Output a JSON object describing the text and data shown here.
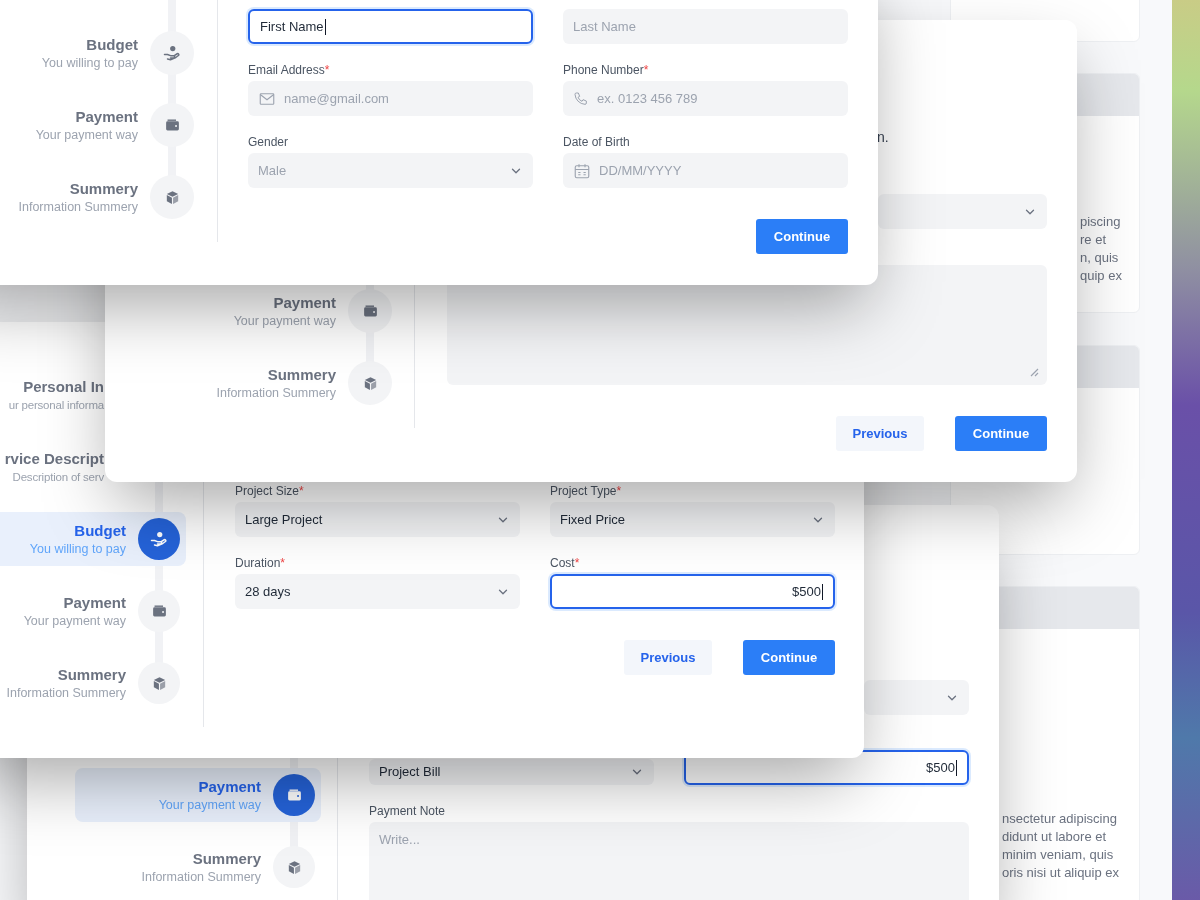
{
  "background_card_text": [
    {
      "lines": [
        "piscing",
        "re et",
        "n, quis",
        "quip ex"
      ]
    },
    {
      "lines": [
        "nsectetur adipiscing",
        "didunt ut labore et",
        "minim veniam, quis",
        "oris nisi ut aliquip ex"
      ]
    }
  ],
  "cards": [
    {
      "steps": [
        {
          "title": "Budget",
          "subtitle": "You willing to pay",
          "kind": "coin",
          "selected": false
        },
        {
          "title": "Payment",
          "subtitle": "Your payment way",
          "kind": "wallet",
          "selected": false
        },
        {
          "title": "Summery",
          "subtitle": "Information Summery",
          "kind": "box",
          "selected": false
        }
      ],
      "fields": [
        {
          "kind": "text",
          "value": "First Name",
          "focused": true
        },
        {
          "kind": "text",
          "placeholder": "Last Name",
          "focused": false
        },
        {
          "kind": "email",
          "label": "Email Address",
          "required_mark": "*",
          "placeholder": "name@gmail.com",
          "focused": false
        },
        {
          "kind": "phone",
          "label": "Phone Number",
          "required_mark": "*",
          "placeholder": "ex. 0123 456 789",
          "focused": false
        },
        {
          "kind": "select",
          "label": "Gender",
          "placeholder": "Male"
        },
        {
          "kind": "date",
          "label": "Date of Birth",
          "placeholder": "DD/MM/YYYY"
        }
      ],
      "buttons": [
        {
          "kind": "primary",
          "label": "Continue"
        }
      ]
    },
    {
      "steps": [
        {
          "title": "Payment",
          "subtitle": "Your payment way",
          "kind": "wallet",
          "selected": false
        },
        {
          "title": "Summery",
          "subtitle": "Information Summery",
          "kind": "box",
          "selected": false
        }
      ],
      "paragraph_fragment": "n.",
      "fields": [
        {
          "kind": "select"
        },
        {
          "kind": "textarea"
        }
      ],
      "buttons": [
        {
          "kind": "secondary",
          "label": "Previous"
        },
        {
          "kind": "primary",
          "label": "Continue"
        }
      ]
    },
    {
      "steps": [
        {
          "title": "Personal In",
          "subtitle": "ur personal informa",
          "kind": "text",
          "selected": false
        },
        {
          "title": "rvice Descript",
          "subtitle": "Description of serv",
          "kind": "text",
          "selected": false
        },
        {
          "title": "Budget",
          "subtitle": "You willing to pay",
          "kind": "coin",
          "selected": true
        },
        {
          "title": "Payment",
          "subtitle": "Your payment way",
          "kind": "wallet",
          "selected": false
        },
        {
          "title": "Summery",
          "subtitle": "Information Summery",
          "kind": "box",
          "selected": false
        }
      ],
      "fields": [
        {
          "kind": "select",
          "label": "Project Size",
          "required_mark": "*",
          "value": "Large Project"
        },
        {
          "kind": "select",
          "label": "Project Type",
          "required_mark": "*",
          "value": "Fixed Price"
        },
        {
          "kind": "select",
          "label": "Duration",
          "required_mark": "*",
          "value": "28 days"
        },
        {
          "kind": "amount",
          "label": "Cost",
          "required_mark": "*",
          "value": "$500",
          "focused": true
        }
      ],
      "buttons": [
        {
          "kind": "secondary",
          "label": "Previous"
        },
        {
          "kind": "primary",
          "label": "Continue"
        }
      ]
    },
    {
      "steps": [
        {
          "title": "Payment",
          "subtitle": "Your payment way",
          "kind": "wallet",
          "selected": true
        },
        {
          "title": "Summery",
          "subtitle": "Information Summery",
          "kind": "box",
          "selected": false
        }
      ],
      "fields": [
        {
          "kind": "select"
        },
        {
          "kind": "select",
          "value": "Project Bill"
        },
        {
          "kind": "amount",
          "value": "$500",
          "focused": true
        },
        {
          "kind": "textarea",
          "label": "Payment Note",
          "placeholder": "Write..."
        }
      ]
    }
  ]
}
